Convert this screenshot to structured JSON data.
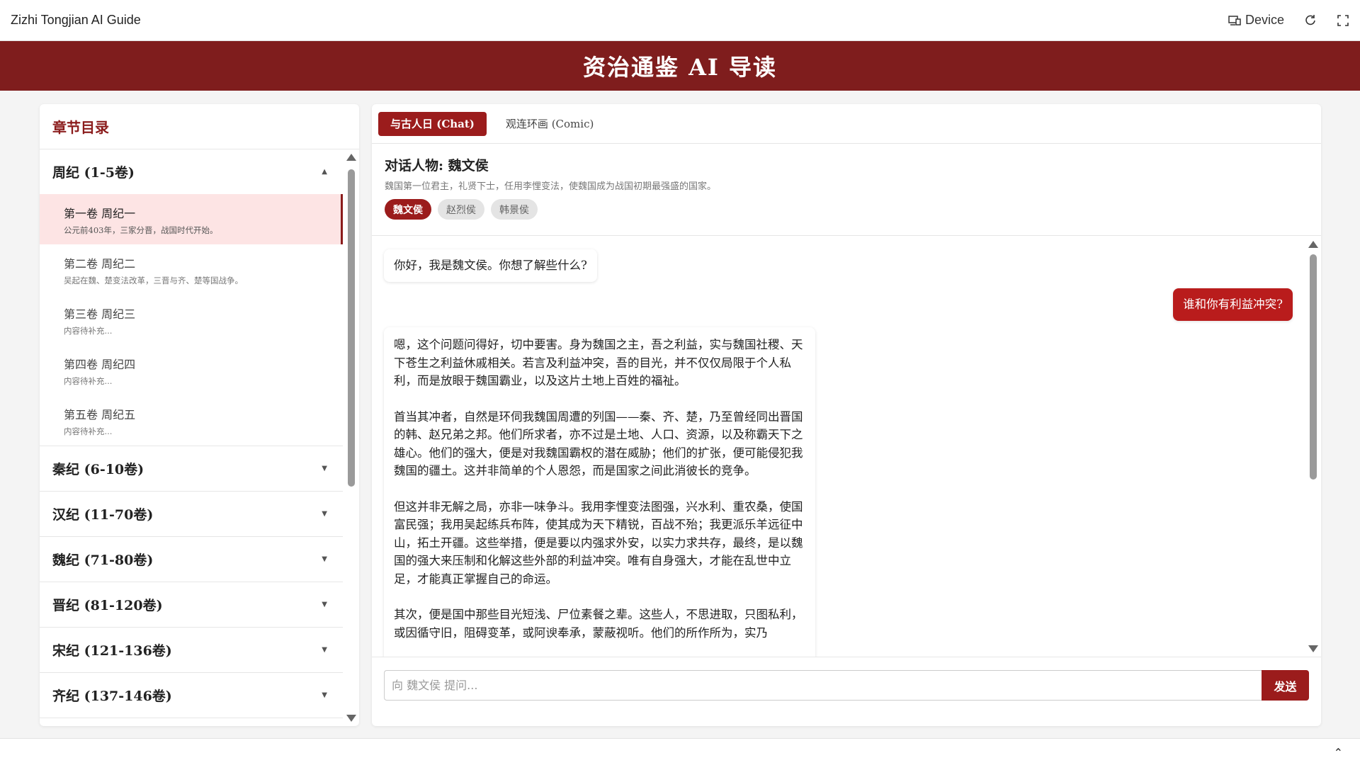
{
  "topbar": {
    "title": "Zizhi Tongjian AI Guide",
    "device_label": "Device",
    "device_icon": "device-icon",
    "refresh_icon": "refresh-icon",
    "fullscreen_icon": "fullscreen-icon"
  },
  "banner": {
    "title": "资治通鉴 AI 导读"
  },
  "sidebar": {
    "header": "章节目录",
    "sections": [
      {
        "label": "周纪 (1-5卷)",
        "expanded": true
      },
      {
        "label": "秦纪 (6-10卷)",
        "expanded": false
      },
      {
        "label": "汉纪 (11-70卷)",
        "expanded": false
      },
      {
        "label": "魏纪 (71-80卷)",
        "expanded": false
      },
      {
        "label": "晋纪 (81-120卷)",
        "expanded": false
      },
      {
        "label": "宋纪 (121-136卷)",
        "expanded": false
      },
      {
        "label": "齐纪 (137-146卷)",
        "expanded": false
      }
    ],
    "chapters": [
      {
        "title": "第一卷 周纪一",
        "desc": "公元前403年，三家分晋，战国时代开始。"
      },
      {
        "title": "第二卷 周纪二",
        "desc": "吴起在魏、楚变法改革，三晋与齐、楚等国战争。"
      },
      {
        "title": "第三卷 周纪三",
        "desc": "内容待补充..."
      },
      {
        "title": "第四卷 周纪四",
        "desc": "内容待补充..."
      },
      {
        "title": "第五卷 周纪五",
        "desc": "内容待补充..."
      }
    ]
  },
  "main": {
    "tabs": [
      {
        "label": "与古人日 (Chat)"
      },
      {
        "label": "观连环画 (Comic)"
      }
    ],
    "persona": {
      "name": "对话人物: 魏文侯",
      "desc": "魏国第一位君主，礼贤下士，任用李悝变法，使魏国成为战国初期最强盛的国家。",
      "chips": [
        "魏文侯",
        "赵烈侯",
        "韩景侯"
      ]
    },
    "messages": {
      "ai_greeting": "你好，我是魏文侯。你想了解些什么?",
      "user_question": "谁和你有利益冲突?",
      "ai_answer": [
        "嗯，这个问题问得好，切中要害。身为魏国之主，吾之利益，实与魏国社稷、天下苍生之利益休戚相关。若言及利益冲突，吾的目光，并不仅仅局限于个人私利，而是放眼于魏国霸业，以及这片土地上百姓的福祉。",
        "首当其冲者，自然是环伺我魏国周遭的列国——秦、齐、楚，乃至曾经同出晋国的韩、赵兄弟之邦。他们所求者，亦不过是土地、人口、资源，以及称霸天下之雄心。他们的强大，便是对我魏国霸权的潜在威胁；他们的扩张，便可能侵犯我魏国的疆土。这并非简单的个人恩怨，而是国家之间此消彼长的竞争。",
        "但这并非无解之局，亦非一味争斗。我用李悝变法图强，兴水利、重农桑，使国富民强；我用吴起练兵布阵，使其成为天下精锐，百战不殆；我更派乐羊远征中山，拓土开疆。这些举措，便是要以内强求外安，以实力求共存，最终，是以魏国的强大来压制和化解这些外部的利益冲突。唯有自身强大，才能在乱世中立足，才能真正掌握自己的命运。",
        "其次，便是国中那些目光短浅、尸位素餐之辈。这些人，不思进取，只图私利，或因循守旧，阻碍变革，或阿谀奉承，蒙蔽视听。他们的所作所为，实乃"
      ]
    },
    "input": {
      "placeholder": "向 魏文侯 提问...",
      "value": "",
      "send_label": "发送"
    }
  },
  "bottom": {
    "collapse_icon": "chevron-up-icon"
  },
  "colors": {
    "brand": "#7f1d1d",
    "accent": "#9b1c1c",
    "user_bubble": "#b91c1c",
    "active_chapter_bg": "#fde4e4"
  }
}
